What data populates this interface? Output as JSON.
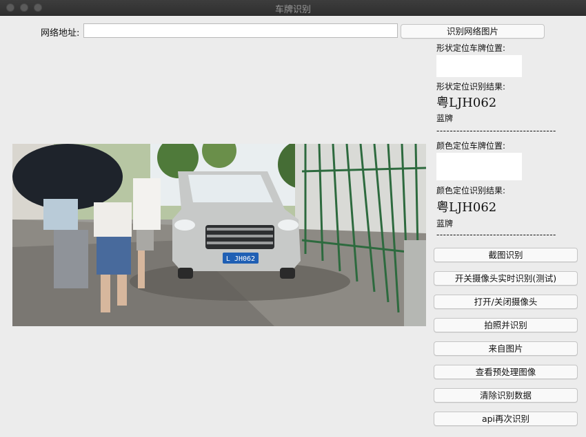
{
  "window": {
    "title": "车牌识别"
  },
  "url_bar": {
    "label": "网络地址:",
    "value": "",
    "button": "识别网络图片"
  },
  "shape_result": {
    "position_label": "形状定位车牌位置:",
    "result_label": "形状定位识别结果:",
    "plate": "粤LJH062",
    "color": "蓝牌"
  },
  "color_result": {
    "position_label": "颜色定位车牌位置:",
    "result_label": "颜色定位识别结果:",
    "plate": "粤LJH062",
    "color": "蓝牌"
  },
  "separator": "------------------------------------",
  "photo": {
    "plate_text": "L JH062"
  },
  "buttons": {
    "screenshot": "截图识别",
    "camera_realtime": "开关摄像头实时识别(测试)",
    "camera_toggle": "打开/关闭摄像头",
    "capture": "拍照并识别",
    "from_image": "来自图片",
    "preprocess": "查看预处理图像",
    "clear": "清除识别数据",
    "api_retry": "api再次识别"
  }
}
